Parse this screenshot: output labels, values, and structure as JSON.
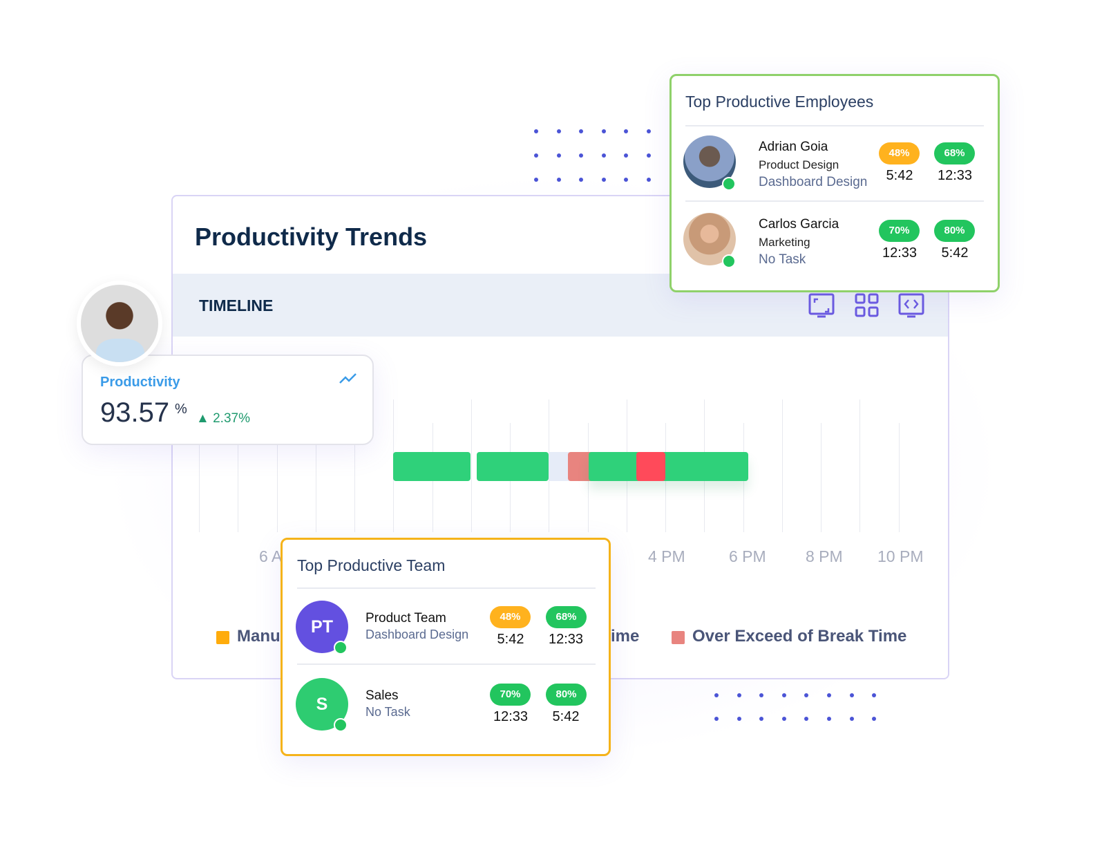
{
  "main": {
    "title": "Productivity Trends",
    "timeline_label": "TIMELINE",
    "icons": [
      "fullscreen-icon",
      "grid-icon",
      "embed-code-icon"
    ],
    "ticks": [
      "6 AM",
      "4 PM",
      "6 PM",
      "8 PM",
      "10 PM"
    ],
    "legend": [
      {
        "label": "Manu",
        "color": "#ffac0c"
      },
      {
        "label": "ime",
        "color": "#4a5578"
      },
      {
        "label": "Over Exceed of Break Time",
        "color": "#e8847f"
      }
    ],
    "colors": {
      "productive": "#2fd17a",
      "idle": "#e6ecf8",
      "break_exceed": "#e8847f",
      "unproductive": "#ff4a5a"
    }
  },
  "productivity": {
    "label": "Productivity",
    "value": "93.57",
    "unit": "%",
    "change": "2.37%",
    "trend": "up"
  },
  "employees": {
    "title": "Top Productive Employees",
    "rows": [
      {
        "name": "Adrian Goia",
        "dept": "Product Design",
        "task": "Dashboard Design",
        "badge1": "48%",
        "badge1_color": "#ffb21e",
        "time1": "5:42",
        "badge2": "68%",
        "badge2_color": "#22c55e",
        "time2": "12:33"
      },
      {
        "name": "Carlos Garcia",
        "dept": "Marketing",
        "task": "No Task",
        "badge1": "70%",
        "badge1_color": "#22c55e",
        "time1": "12:33",
        "badge2": "80%",
        "badge2_color": "#22c55e",
        "time2": "5:42"
      }
    ]
  },
  "team": {
    "title": "Top Productive Team",
    "rows": [
      {
        "initials": "PT",
        "color": "#6350e0",
        "name": "Product Team",
        "task": "Dashboard Design",
        "badge1": "48%",
        "badge1_color": "#ffb21e",
        "time1": "5:42",
        "badge2": "68%",
        "badge2_color": "#22c55e",
        "time2": "12:33"
      },
      {
        "initials": "S",
        "color": "#2ecc71",
        "name": "Sales",
        "task": "No Task",
        "badge1": "70%",
        "badge1_color": "#22c55e",
        "time1": "12:33",
        "badge2": "80%",
        "badge2_color": "#22c55e",
        "time2": "5:42"
      }
    ]
  }
}
